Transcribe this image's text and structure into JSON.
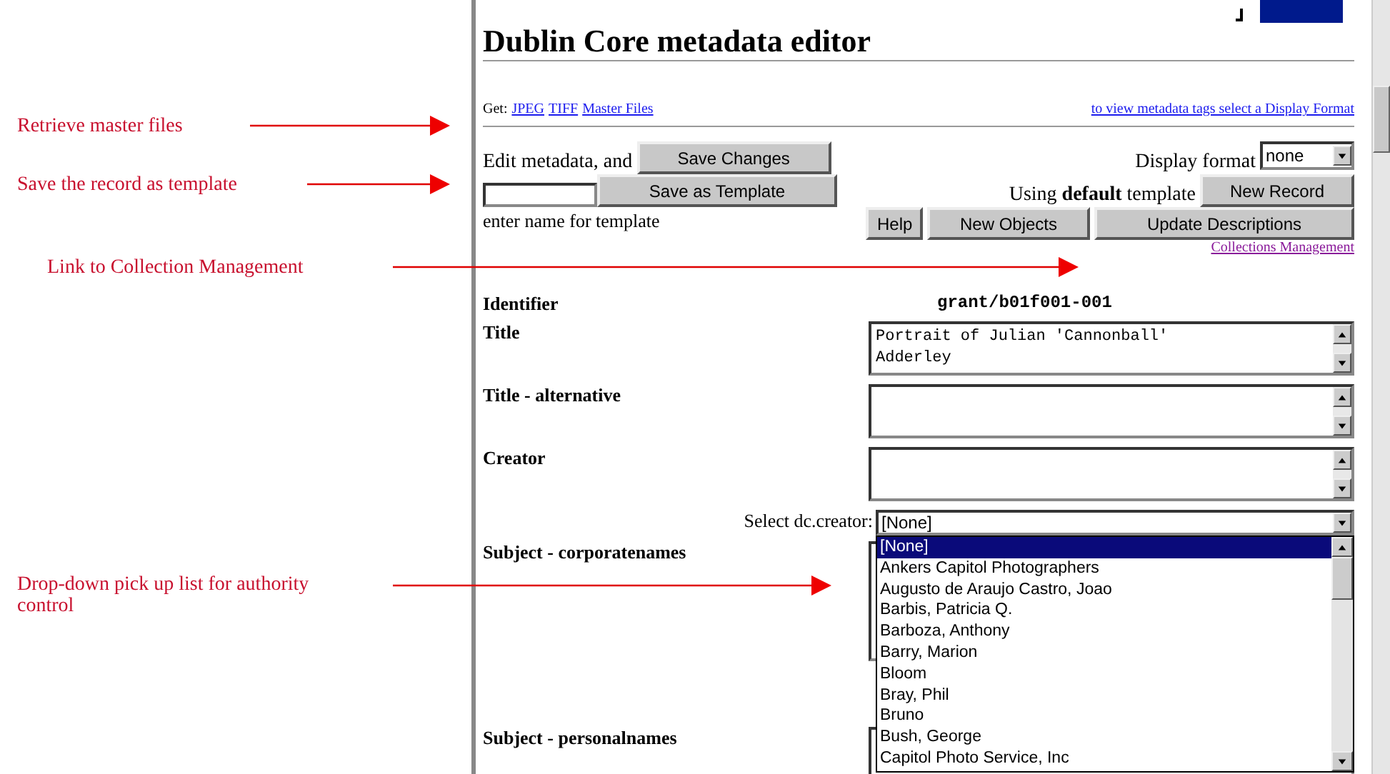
{
  "annotations": [
    {
      "text": "Retrieve master files"
    },
    {
      "text": "Save the record as template"
    },
    {
      "text": "Link to Collection Management"
    },
    {
      "text": "Drop-down pick up list for authority control"
    }
  ],
  "header": {
    "title": "Dublin Core metadata editor"
  },
  "get_bar": {
    "label": "Get:",
    "links": [
      "JPEG",
      "TIFF",
      "Master Files"
    ],
    "format_link": "to view metadata tags select a Display Format"
  },
  "form": {
    "edit_label": "Edit metadata, and",
    "save_changes": "Save Changes",
    "save_template": "Save as Template",
    "template_hint": "enter name for template",
    "display_format_label": "Display format",
    "display_format_value": "none",
    "using_template": "Using **default** template",
    "new_record": "New Record",
    "buttons": [
      "Help",
      "New Objects",
      "Update Descriptions"
    ],
    "collections_link": "Collections Management"
  },
  "fields": [
    {
      "kind": "value",
      "label": "Identifier",
      "value": "grant/b01f001-001"
    },
    {
      "kind": "textarea",
      "label": "Title",
      "value": "Portrait of Julian 'Cannonball'\nAdderley"
    },
    {
      "kind": "textarea",
      "label": "Title - alternative"
    },
    {
      "kind": "textarea",
      "label": "Creator"
    },
    {
      "kind": "select",
      "label": "Select dc.creator:",
      "value": "[None]",
      "open": true,
      "options": [
        {
          "label": "[None]",
          "selected": true
        },
        {
          "label": "Ankers Capitol Photographers",
          "selected": false
        },
        {
          "label": "Augusto de Araujo Castro, Joao",
          "selected": false
        },
        {
          "label": "Barbis, Patricia Q.",
          "selected": false
        },
        {
          "label": "Barboza, Anthony",
          "selected": false
        },
        {
          "label": "Barry, Marion",
          "selected": false
        },
        {
          "label": "Bloom",
          "selected": false
        },
        {
          "label": "Bray, Phil",
          "selected": false
        },
        {
          "label": "Bruno",
          "selected": false
        },
        {
          "label": "Bush, George",
          "selected": false
        },
        {
          "label": "Capitol Photo Service, Inc",
          "selected": false
        }
      ]
    },
    {
      "kind": "tallarea",
      "label": "Subject - corporatenames"
    },
    {
      "kind": "tallarea",
      "label": "Subject - personalnames"
    }
  ]
}
